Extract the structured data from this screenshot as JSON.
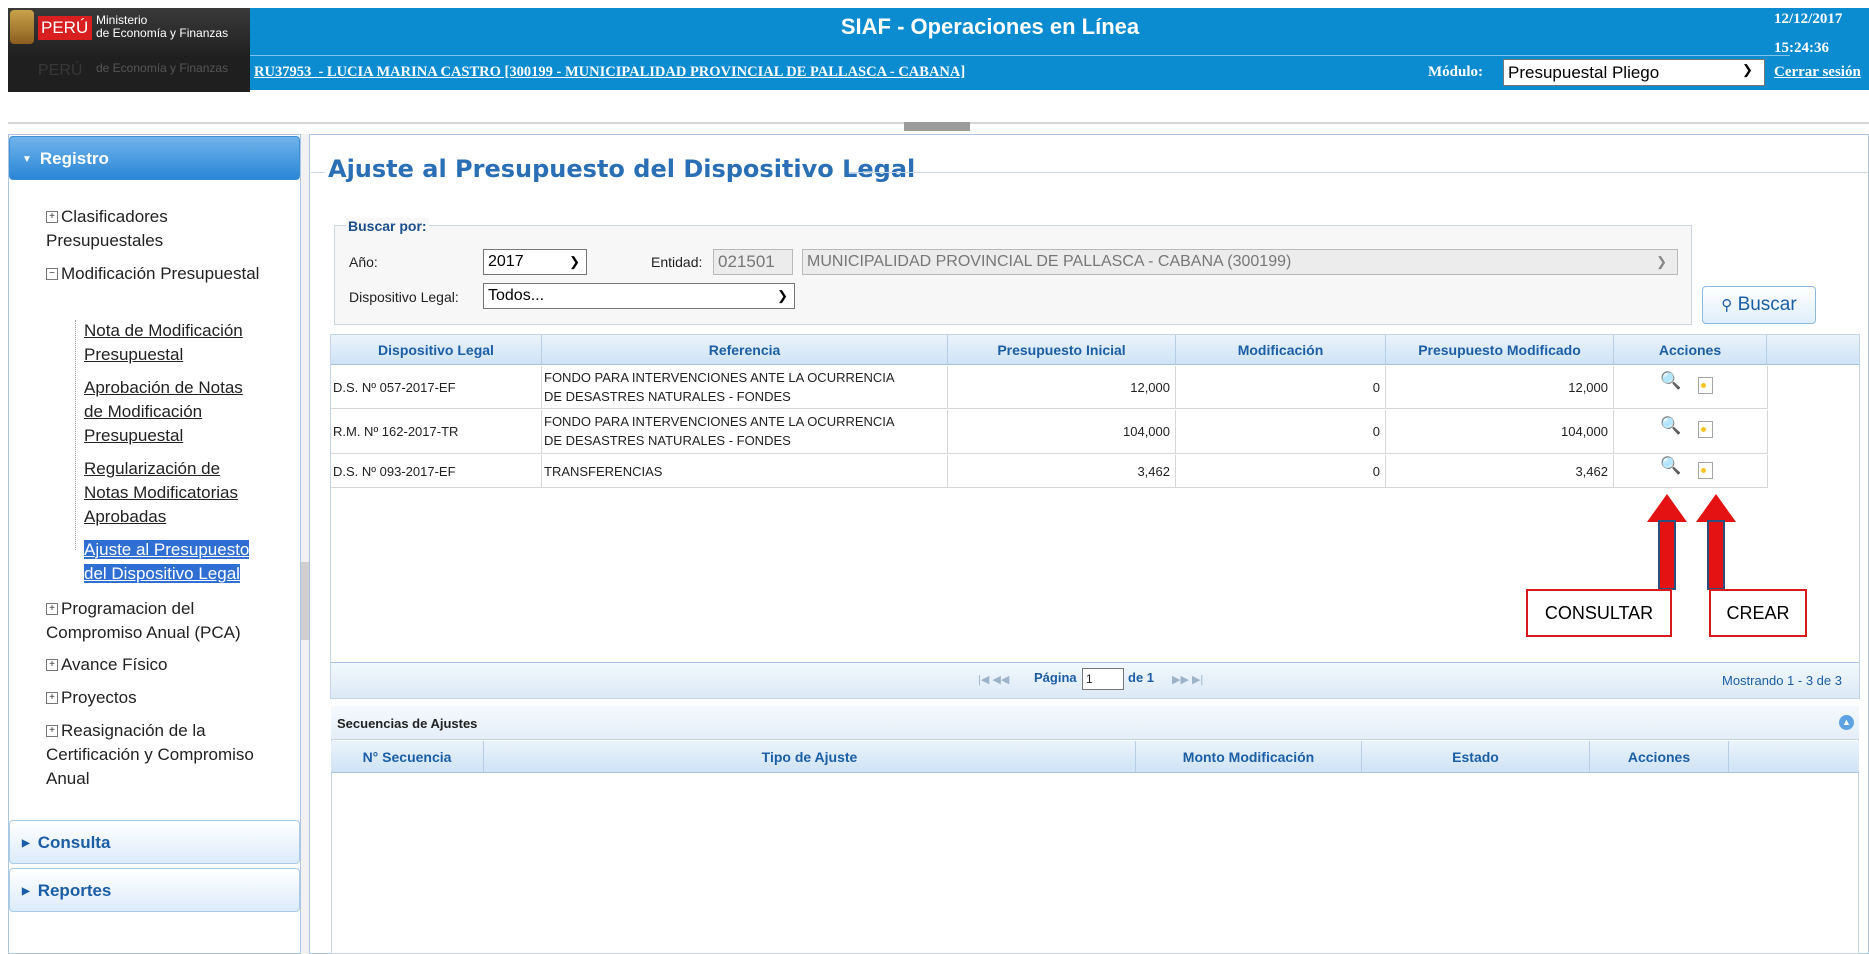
{
  "header": {
    "brand_peru": "PERÚ",
    "brand_ministry_line1": "Ministerio",
    "brand_ministry_line2": "de Economía y Finanzas",
    "app_title": "SIAF - Operaciones en Línea",
    "date": "12/12/2017",
    "time": "15:24:36",
    "user_line": "RU37953  - LUCIA MARINA CASTRO [300199 - MUNICIPALIDAD PROVINCIAL DE PALLASCA - CABANA]",
    "module_label": "Módulo:",
    "module_value": "Presupuestal Pliego",
    "logout": "Cerrar sesión"
  },
  "sidebar": {
    "registro": "Registro",
    "consulta": "Consulta",
    "reportes": "Reportes",
    "items": {
      "clasificadores": "Clasificadores Presupuestales",
      "modificacion": "Modificación Presupuestal",
      "nota": "Nota de Modificación Presupuestal",
      "aprobacion": "Aprobación de Notas de Modificación Presupuestal",
      "regularizacion": "Regularización de Notas Modificatorias Aprobadas",
      "ajuste": "Ajuste al Presupuesto del Dispositivo Legal",
      "pca": "Programacion del Compromiso Anual (PCA)",
      "avance": "Avance Físico",
      "proyectos": "Proyectos",
      "reasignacion": "Reasignación de la Certificación y Compromiso Anual"
    }
  },
  "main": {
    "title": "Ajuste al Presupuesto del Dispositivo Legal",
    "search": {
      "legend": "Buscar por:",
      "year_label": "Año:",
      "year_value": "2017",
      "entity_label": "Entidad:",
      "entity_code": "021501",
      "entity_name": "MUNICIPALIDAD PROVINCIAL DE PALLASCA - CABANA (300199)",
      "device_label": "Dispositivo Legal:",
      "device_value": "Todos...",
      "search_button": "Buscar"
    },
    "grid": {
      "columns": [
        "Dispositivo Legal",
        "Referencia",
        "Presupuesto Inicial",
        "Modificación",
        "Presupuesto Modificado",
        "Acciones"
      ],
      "rows": [
        {
          "dispositivo": "D.S. Nº 057-2017-EF",
          "ref1": "FONDO PARA INTERVENCIONES ANTE LA OCURRENCIA",
          "ref2": "DE DESASTRES NATURALES - FONDES",
          "inicial": "12,000",
          "modificacion": "0",
          "modificado": "12,000"
        },
        {
          "dispositivo": "R.M. Nº 162-2017-TR",
          "ref1": "FONDO PARA INTERVENCIONES ANTE LA OCURRENCIA",
          "ref2": "DE DESASTRES NATURALES - FONDES",
          "inicial": "104,000",
          "modificacion": "0",
          "modificado": "104,000"
        },
        {
          "dispositivo": "D.S. Nº 093-2017-EF",
          "ref1": "TRANSFERENCIAS",
          "ref2": "",
          "inicial": "3,462",
          "modificacion": "0",
          "modificado": "3,462"
        }
      ],
      "pager": {
        "page_label": "Página",
        "page_value": "1",
        "of_label": "de 1",
        "showing": "Mostrando 1 - 3 de 3"
      }
    },
    "annotations": {
      "consultar": "CONSULTAR",
      "crear": "CREAR"
    },
    "sequences": {
      "title": "Secuencias de Ajustes",
      "columns": [
        "N° Secuencia",
        "Tipo de Ajuste",
        "Monto Modificación",
        "Estado",
        "Acciones"
      ]
    }
  },
  "colors": {
    "header_blue": "#0b8bd0",
    "accent_red": "#e41212",
    "title_blue": "#2a6fb5"
  },
  "icons": [
    "search-icon",
    "document-icon",
    "plus-icon",
    "minus-icon",
    "chevron-down-icon",
    "collapse-icon"
  ]
}
